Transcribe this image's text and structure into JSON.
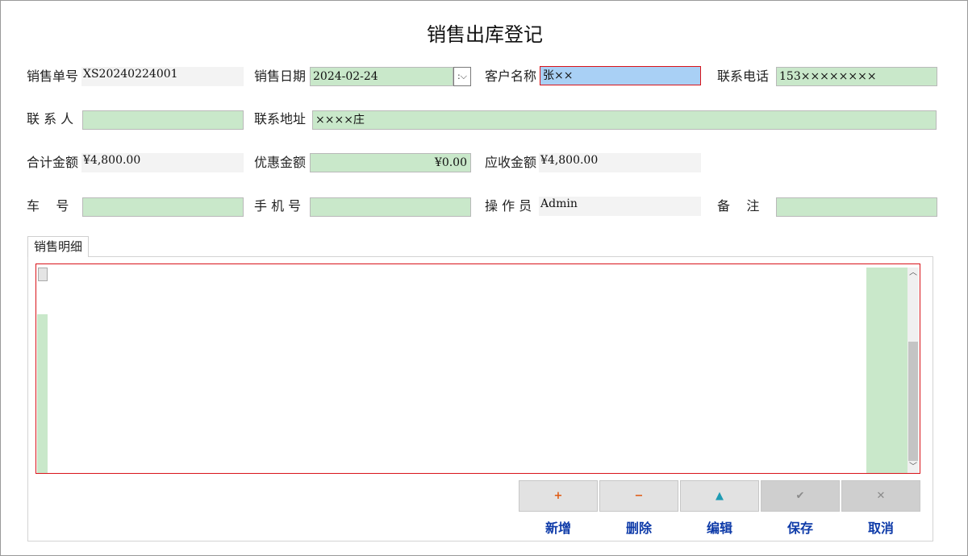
{
  "window": {
    "title": "销售出库登记"
  },
  "form": {
    "order_no_label": "销售单号",
    "order_no_value": "XS20240224001",
    "sale_date_label": "销售日期",
    "sale_date_value": "2024-02-24",
    "sale_date_dropdown_glyph": ":⌵",
    "customer_label": "客户名称",
    "customer_value": "张××",
    "phone_label": "联系电话",
    "phone_value": "153××××××××",
    "contact_label": "联 系 人",
    "contact_value": "",
    "address_label": "联系地址",
    "address_value": "××××庄",
    "total_label": "合计金额",
    "total_value": "¥4,800.00",
    "discount_label": "优惠金额",
    "discount_value": "¥0.00",
    "receivable_label": "应收金额",
    "receivable_value": "¥4,800.00",
    "car_label": "车    号",
    "car_value": "",
    "mobile_label": "手 机 号",
    "mobile_value": "",
    "operator_label": "操 作 员",
    "operator_value": "Admin",
    "remark_label": "备    注",
    "remark_value": ""
  },
  "detail_tab": {
    "label": "销售明细"
  },
  "toolbar": {
    "buttons": [
      {
        "label": "新增",
        "icon": "plus-icon",
        "glyph": "+",
        "color": "#e05a12",
        "enabled": true
      },
      {
        "label": "删除",
        "icon": "minus-icon",
        "glyph": "−",
        "color": "#e05a12",
        "enabled": true
      },
      {
        "label": "编辑",
        "icon": "triangle-up-icon",
        "glyph": "▲",
        "color": "#1f9bb3",
        "enabled": true
      },
      {
        "label": "保存",
        "icon": "check-icon",
        "glyph": "✔",
        "color": "#8a8a8a",
        "enabled": false
      },
      {
        "label": "取消",
        "icon": "cross-icon",
        "glyph": "✕",
        "color": "#8a8a8a",
        "enabled": false
      }
    ]
  },
  "colors": {
    "input_bg": "#c9e8ca",
    "focus_bg": "#a9d0f5",
    "focus_border": "#d9141a",
    "button_label": "#0d3aa8"
  }
}
